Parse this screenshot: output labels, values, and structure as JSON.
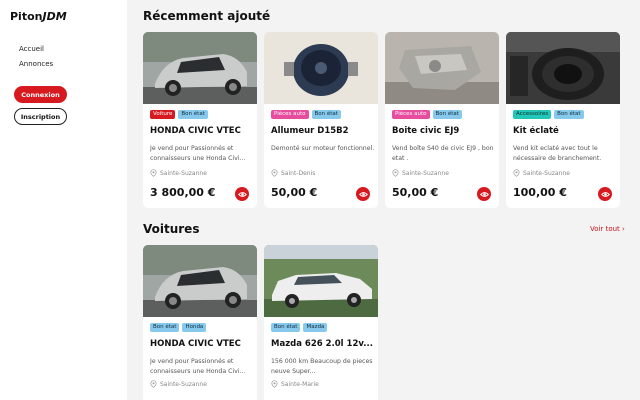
{
  "sidebar": {
    "logo_plain": "Piton",
    "logo_italic": "JDM",
    "nav": [
      "Accueil",
      "Annonces"
    ],
    "login_label": "Connexion",
    "signup_label": "Inscription"
  },
  "sections": {
    "recent_title": "Récemment ajouté",
    "cars_title": "Voitures",
    "see_all_label": "Voir tout"
  },
  "recent": [
    {
      "tags": [
        "Voiture",
        "Bon état"
      ],
      "title": "HONDA CIVIC VTEC",
      "desc": "Je vend pour Passionnés et connaisseurs une Honda Civi...",
      "location": "Sainte-Suzanne",
      "price": "3 800,00 €"
    },
    {
      "tags": [
        "Pièces auto",
        "Bon état"
      ],
      "title": "Allumeur D15B2",
      "desc": "Demonté sur moteur fonctionnel.",
      "location": "Saint-Denis",
      "price": "50,00 €"
    },
    {
      "tags": [
        "Pièces auto",
        "Bon état"
      ],
      "title": "Boite civic EJ9",
      "desc": "Vend boîte S40 de civic EJ9 , bon etat .",
      "location": "Sainte-Suzanne",
      "price": "50,00 €"
    },
    {
      "tags": [
        "Accessoires",
        "Bon état"
      ],
      "title": "Kit éclaté",
      "desc": "Vend kit eclaté avec tout le nécessaire de branchement.",
      "location": "Sainte-Suzanne",
      "price": "100,00 €"
    }
  ],
  "cars": [
    {
      "tags": [
        "Bon état",
        "Honda"
      ],
      "title": "HONDA CIVIC VTEC",
      "desc": "Je vend pour Passionnés et connaisseurs une Honda Civi...",
      "location": "Sainte-Suzanne"
    },
    {
      "tags": [
        "Bon état",
        "Mazda"
      ],
      "title": "Mazda 626 2.0l 12v...",
      "desc": "156 000 km Beaucoup de pieces neuve Super...",
      "location": "Sainte-Marie"
    }
  ],
  "colors": {
    "accent": "#d71920",
    "tag_blue": "#87c9ec",
    "tag_pink": "#e84c9e",
    "tag_teal": "#22c7b8"
  },
  "icons": [
    "location-pin-icon",
    "eye-icon",
    "chevron-right-icon"
  ]
}
